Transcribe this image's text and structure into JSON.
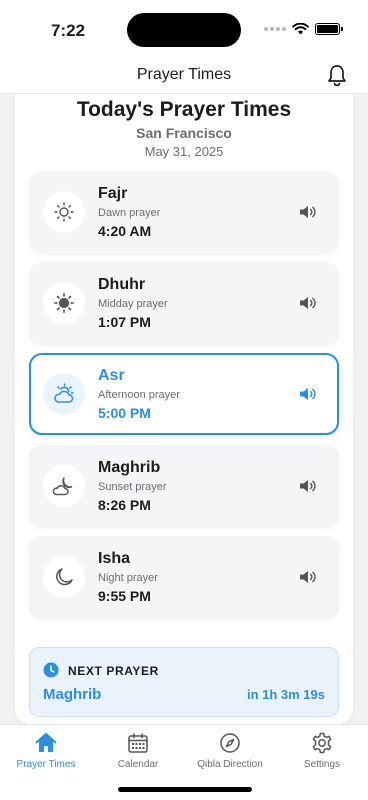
{
  "status_bar": {
    "time": "7:22"
  },
  "nav": {
    "title": "Prayer Times",
    "bell_icon": "bell-icon"
  },
  "header": {
    "title": "Today's Prayer Times",
    "city": "San Francisco",
    "date": "May 31, 2025"
  },
  "prayers": [
    {
      "name": "Fajr",
      "description": "Dawn prayer",
      "time": "4:20 AM",
      "icon": "sunrise-icon",
      "active": false
    },
    {
      "name": "Dhuhr",
      "description": "Midday prayer",
      "time": "1:07 PM",
      "icon": "sun-icon",
      "active": false
    },
    {
      "name": "Asr",
      "description": "Afternoon prayer",
      "time": "5:00 PM",
      "icon": "cloud-sun-icon",
      "active": true
    },
    {
      "name": "Maghrib",
      "description": "Sunset prayer",
      "time": "8:26 PM",
      "icon": "cloud-moon-icon",
      "active": false
    },
    {
      "name": "Isha",
      "description": "Night prayer",
      "time": "9:55 PM",
      "icon": "moon-icon",
      "active": false
    }
  ],
  "next_prayer": {
    "label": "NEXT PRAYER",
    "name": "Maghrib",
    "countdown": "in 1h 3m 19s"
  },
  "tabs": [
    {
      "label": "Prayer Times",
      "icon": "home-icon",
      "active": true
    },
    {
      "label": "Calendar",
      "icon": "calendar-icon",
      "active": false
    },
    {
      "label": "Qibla Direction",
      "icon": "compass-icon",
      "active": false
    },
    {
      "label": "Settings",
      "icon": "gear-icon",
      "active": false
    }
  ],
  "colors": {
    "accent": "#2a8fe0",
    "text": "#1c1c1e",
    "secondary": "#6c6c70",
    "card": "#f5f5f7"
  }
}
